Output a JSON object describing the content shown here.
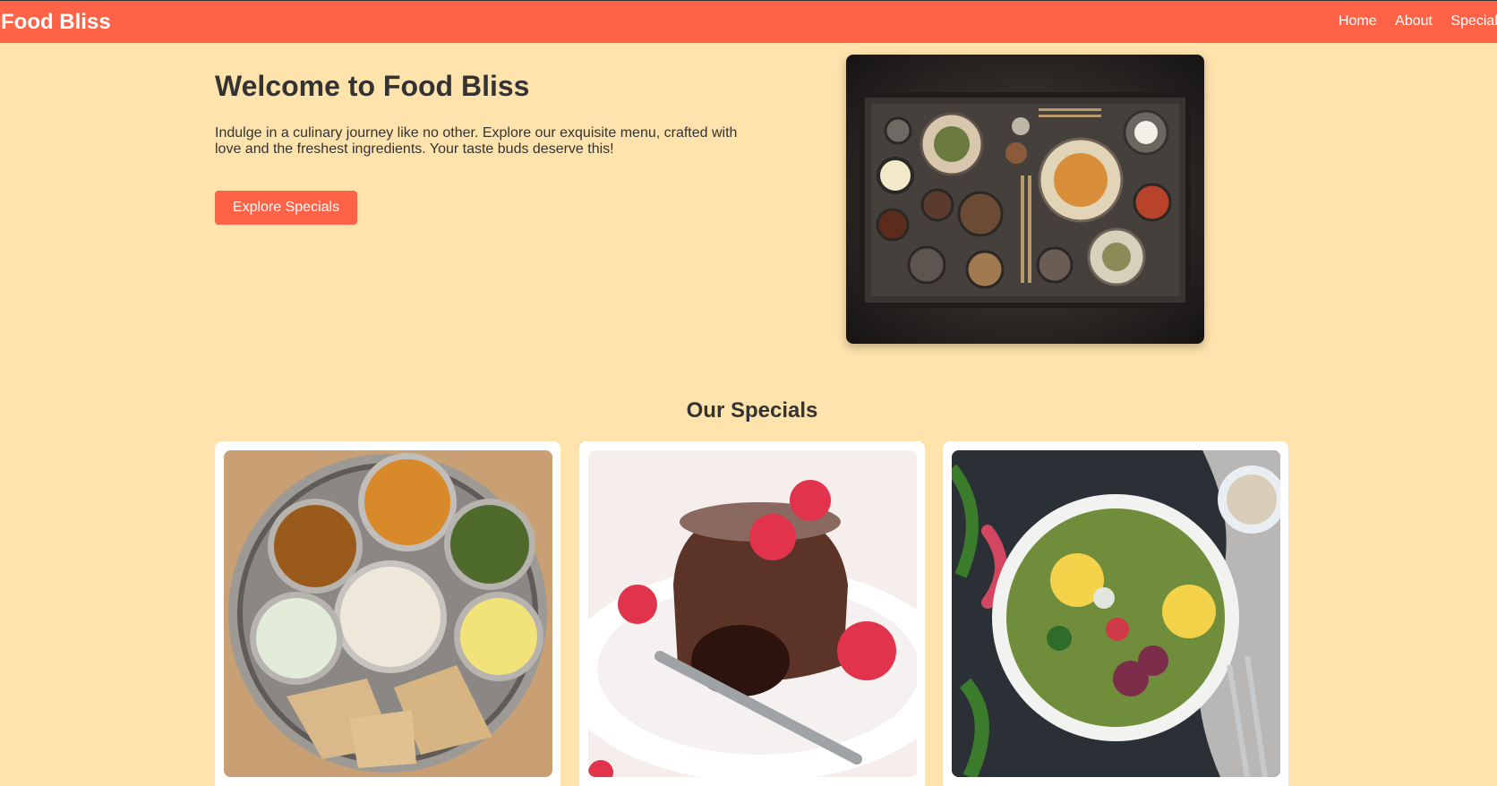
{
  "navbar": {
    "brand": "Food Bliss",
    "links": [
      {
        "label": "Home"
      },
      {
        "label": "About"
      },
      {
        "label": "Specials"
      }
    ]
  },
  "hero": {
    "title": "Welcome to Food Bliss",
    "description": "Indulge in a culinary journey like no other. Explore our exquisite menu, crafted with love and the freshest ingredients. Your taste buds deserve this!",
    "button_label": "Explore Specials",
    "image_alt": "Assorted dishes on a dark tray"
  },
  "specials": {
    "title": "Our Specials",
    "cards": [
      {
        "image_alt": "Indian thali platter"
      },
      {
        "image_alt": "Chocolate lava cake with raspberries"
      },
      {
        "image_alt": "Fresh vegetable salad bowl"
      }
    ]
  },
  "colors": {
    "accent": "#ff6347",
    "background": "#ffe3ad",
    "text": "#333333",
    "card": "#ffffff"
  }
}
